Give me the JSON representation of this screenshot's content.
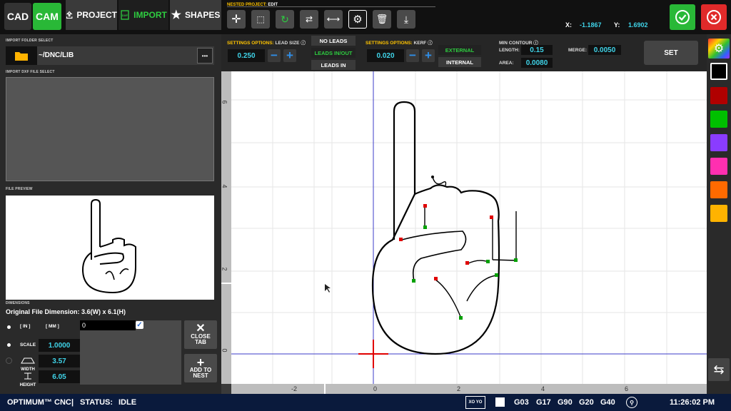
{
  "top": {
    "cad_label": "CAD",
    "cam_label": "CAM",
    "project_label": "PROJECT",
    "import_label": "IMPORT",
    "shapes_label": "SHAPES",
    "nested_project_label": "NESTED PROJECT:",
    "nested_project_mode": "EDIT",
    "x_label": "X:",
    "x_value": "-1.1867",
    "y_label": "Y:",
    "y_value": "1.6902"
  },
  "left": {
    "import_folder_label": "IMPORT FOLDER SELECT",
    "folder_path": "~/DNC/LIB",
    "more_label": "•••",
    "import_file_label": "IMPORT DXF FILE SELECT",
    "preview_label": "FILE PREVIEW",
    "dimensions_label": "DIMENSIONS",
    "original_dimension": "Original File Dimension: 3.6(W) x 6.1(H)",
    "unit_in": "[ IN ]",
    "unit_mm": "[ MM ]",
    "scale_label": "SCALE",
    "scale_value": "1.0000",
    "width_label": "WIDTH",
    "width_value": "3.57",
    "height_label": "HEIGHT",
    "height_value": "6.05",
    "name_value": "0",
    "close_tab_label1": "CLOSE",
    "close_tab_label2": "TAB",
    "add_nest_label1": "ADD TO",
    "add_nest_label2": "NEST"
  },
  "settings": {
    "lead_prefix": "SETTINGS OPTIONS:",
    "lead_label": "LEAD SIZE",
    "lead_value": "0.250",
    "no_leads": "NO LEADS",
    "leads_inout": "LEADS IN/OUT",
    "leads_in": "LEADS IN",
    "kerf_prefix": "SETTINGS OPTIONS:",
    "kerf_label": "KERF",
    "kerf_value": "0.020",
    "external": "EXTERNAL",
    "internal": "INTERNAL",
    "min_contour": "MIN CONTOUR",
    "length_label": "LENGTH:",
    "length_value": "0.15",
    "area_label": "AREA:",
    "area_value": "0.0080",
    "merge_label": "MERGE:",
    "merge_value": "0.0050",
    "set_label": "SET"
  },
  "canvas": {
    "x_ticks": [
      "-2",
      "0",
      "2",
      "4",
      "6"
    ],
    "y_ticks": [
      "0",
      "2",
      "4",
      "6"
    ]
  },
  "colors": [
    "#000000",
    "#b00000",
    "#00c000",
    "#8a3cff",
    "#ff2fb0",
    "#ff6a00",
    "#ffb300"
  ],
  "status": {
    "app_name": "OPTIMUM™ CNC",
    "status_label": "STATUS:",
    "status_value": "IDLE",
    "xoyo": "XO YO",
    "gcodes": [
      "G03",
      "G17",
      "G90",
      "G20",
      "G40"
    ],
    "time": "11:26:02 PM"
  }
}
